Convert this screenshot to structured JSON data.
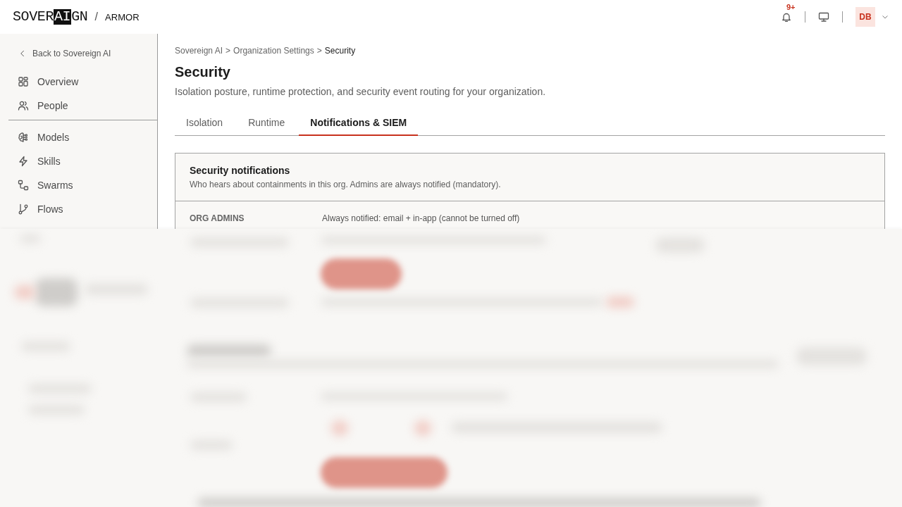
{
  "header": {
    "logo": {
      "prefix": "SOVER",
      "highlight": "AI",
      "suffix": "GN"
    },
    "separator": "/",
    "product": "ARMOR",
    "notification_count": "9+",
    "avatar_initials": "DB"
  },
  "sidebar": {
    "back_link": "Back to Sovereign AI",
    "groups": [
      {
        "items": [
          {
            "label": "Overview",
            "selected": false
          },
          {
            "label": "People",
            "selected": false
          }
        ]
      },
      {
        "items": [
          {
            "label": "Models",
            "selected": false
          },
          {
            "label": "Skills",
            "selected": false
          },
          {
            "label": "Swarms",
            "selected": false
          },
          {
            "label": "Flows",
            "selected": false
          }
        ]
      }
    ]
  },
  "breadcrumb": [
    {
      "label": "Sovereign AI",
      "current": false,
      "separator": ">"
    },
    {
      "label": "Organization Settings",
      "current": false,
      "separator": ">"
    },
    {
      "label": "Security",
      "current": true
    }
  ],
  "page": {
    "title": "Security",
    "description": "Isolation posture, runtime protection, and security event routing for your organization."
  },
  "tabs": [
    {
      "label": "Isolation",
      "selected": false
    },
    {
      "label": "Runtime",
      "selected": false
    },
    {
      "label": "Notifications & SIEM",
      "selected": true
    }
  ],
  "card": {
    "title": "Security notifications",
    "description": "Who hears about containments in this org. Admins are always notified (mandatory).",
    "rows": [
      {
        "label": "ORG ADMINS",
        "value": "Always notified: email + in-app (cannot be turned off)"
      }
    ]
  },
  "content_blurred": true
}
